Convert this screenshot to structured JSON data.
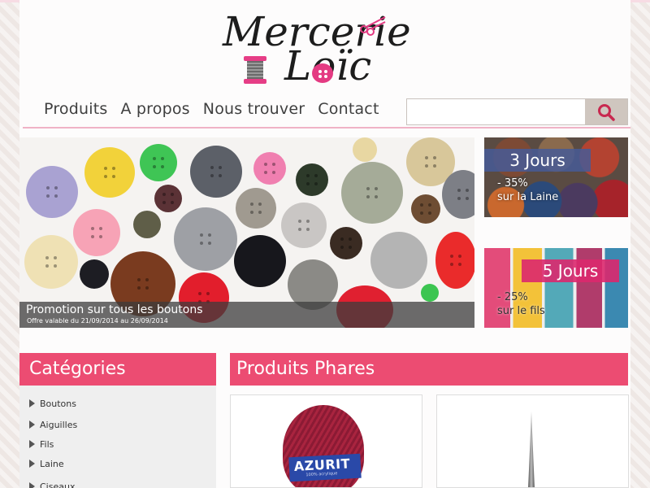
{
  "logo": {
    "line1": "Mercerie",
    "line2": "Loïc"
  },
  "nav": {
    "items": [
      "Produits",
      "A propos",
      "Nous trouver",
      "Contact"
    ]
  },
  "search": {
    "placeholder": "",
    "button_icon": "search-icon"
  },
  "hero": {
    "title": "Promotion sur tous les boutons",
    "subtitle": "Offre valable du 21/09/2014 au 26/09/2014"
  },
  "promos": [
    {
      "label": "3 Jours",
      "line1": "- 35%",
      "line2": "sur la Laine"
    },
    {
      "label": "5 Jours",
      "line1": "- 25%",
      "line2": "sur le fils"
    }
  ],
  "categories": {
    "title": "Catégories",
    "items": [
      "Boutons",
      "Aiguilles",
      "Fils",
      "Laine",
      "Ciseaux"
    ]
  },
  "featured": {
    "title": "Produits Phares",
    "products": [
      {
        "brand": "AZURIT",
        "tag": "100% acrylique"
      },
      {
        "brand": ""
      }
    ]
  },
  "colors": {
    "accent": "#ec4c72",
    "nav_text": "#3f3f3f",
    "search_button": "#cfc6bf"
  }
}
